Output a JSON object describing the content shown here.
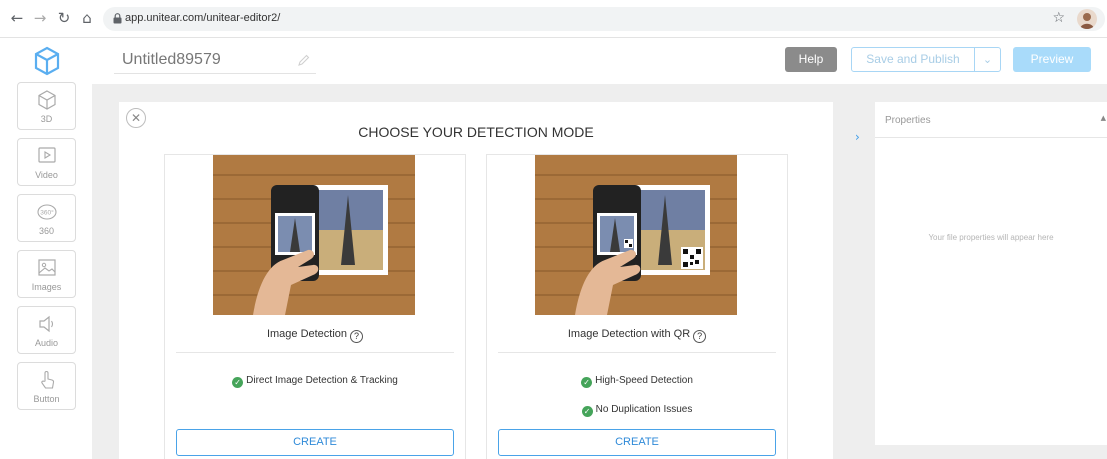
{
  "browser": {
    "url": "app.unitear.com/unitear-editor2/",
    "back_icon": "arrow-left-icon",
    "forward_icon": "arrow-right-icon",
    "reload_icon": "reload-icon",
    "home_icon": "home-icon"
  },
  "editor": {
    "title": "Untitled89579",
    "help_label": "Help",
    "save_label": "Save and Publish",
    "preview_label": "Preview"
  },
  "tools": [
    {
      "label": "3D",
      "icon": "cube-icon"
    },
    {
      "label": "Video",
      "icon": "video-icon"
    },
    {
      "label": "360",
      "icon": "360-icon"
    },
    {
      "label": "Images",
      "icon": "image-icon"
    },
    {
      "label": "Audio",
      "icon": "speaker-icon"
    },
    {
      "label": "Button",
      "icon": "touch-icon"
    }
  ],
  "modal": {
    "title": "CHOOSE YOUR DETECTION MODE",
    "cards": [
      {
        "title": "Image Detection",
        "help": "?",
        "features": [
          "Direct Image Detection & Tracking"
        ],
        "create_label": "CREATE"
      },
      {
        "title": "Image Detection with QR",
        "help": "?",
        "features": [
          "High-Speed Detection",
          "No Duplication Issues"
        ],
        "create_label": "CREATE"
      }
    ]
  },
  "properties": {
    "title": "Properties",
    "empty_text": "Your file properties will appear here"
  },
  "colors": {
    "accent": "#2f8ad8",
    "check": "#45a45a",
    "help_button": "#8b8b8b",
    "preview_button": "#a9dbfa"
  }
}
